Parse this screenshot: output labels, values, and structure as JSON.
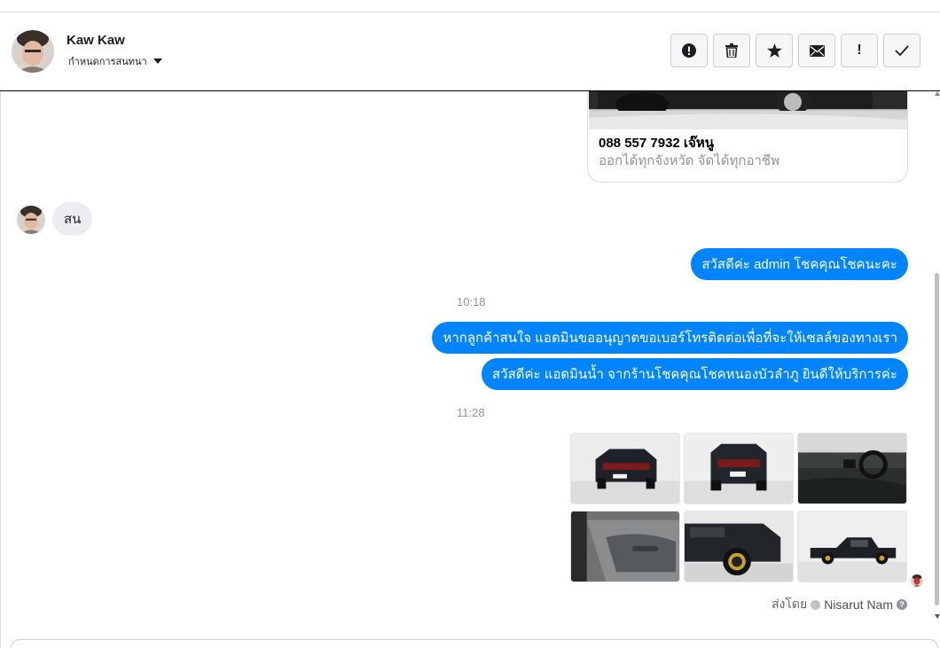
{
  "header": {
    "contact_name": "Kaw Kaw",
    "conversation_settings_label": "กำหนดการสนทนา",
    "toolbar": [
      {
        "name": "spam-button",
        "icon": "alert-circle-icon"
      },
      {
        "name": "delete-button",
        "icon": "trash-icon"
      },
      {
        "name": "star-button",
        "icon": "star-icon"
      },
      {
        "name": "mark-unread-button",
        "icon": "envelope-icon"
      },
      {
        "name": "follow-up-button",
        "icon": "exclamation-icon",
        "glyph": "!"
      },
      {
        "name": "done-button",
        "icon": "check-icon"
      }
    ]
  },
  "messages": {
    "card": {
      "title": "088 557 7932 เจ๊หนู",
      "subtitle": "ออกได้ทุกจังหวัด จัดได้ทุกอาชีพ"
    },
    "incoming_1": "สน",
    "outgoing_1": "สวัสดีค่ะ admin โชคคุณโชคนะคะ",
    "timestamp_1": "10:18",
    "outgoing_2": "หากลูกค้าสนใจ แอดมินขออนุญาตขอเบอร์โทรติดต่อเพื่อที่จะให้เซลล์ของทางเรา",
    "outgoing_3": "สวัสดีค่ะ แอดมินน้ำ จากร้านโชคคุณโชคหนองบัวลำภู ยินดีให้บริการค่ะ",
    "timestamp_2": "11:28",
    "gallery_photos": [
      "front-truck-photo",
      "front-truck-photo-2",
      "interior-dashboard-photo",
      "door-panel-photo",
      "side-wheel-photo",
      "side-profile-photo"
    ],
    "sent_by_label": "ส่งโดย",
    "sent_by_agent": "Nisarut Nam",
    "help_glyph": "?"
  },
  "colors": {
    "accent": "#0084ff",
    "incoming_bubble": "#ebedf0",
    "muted_text": "#90949c"
  }
}
